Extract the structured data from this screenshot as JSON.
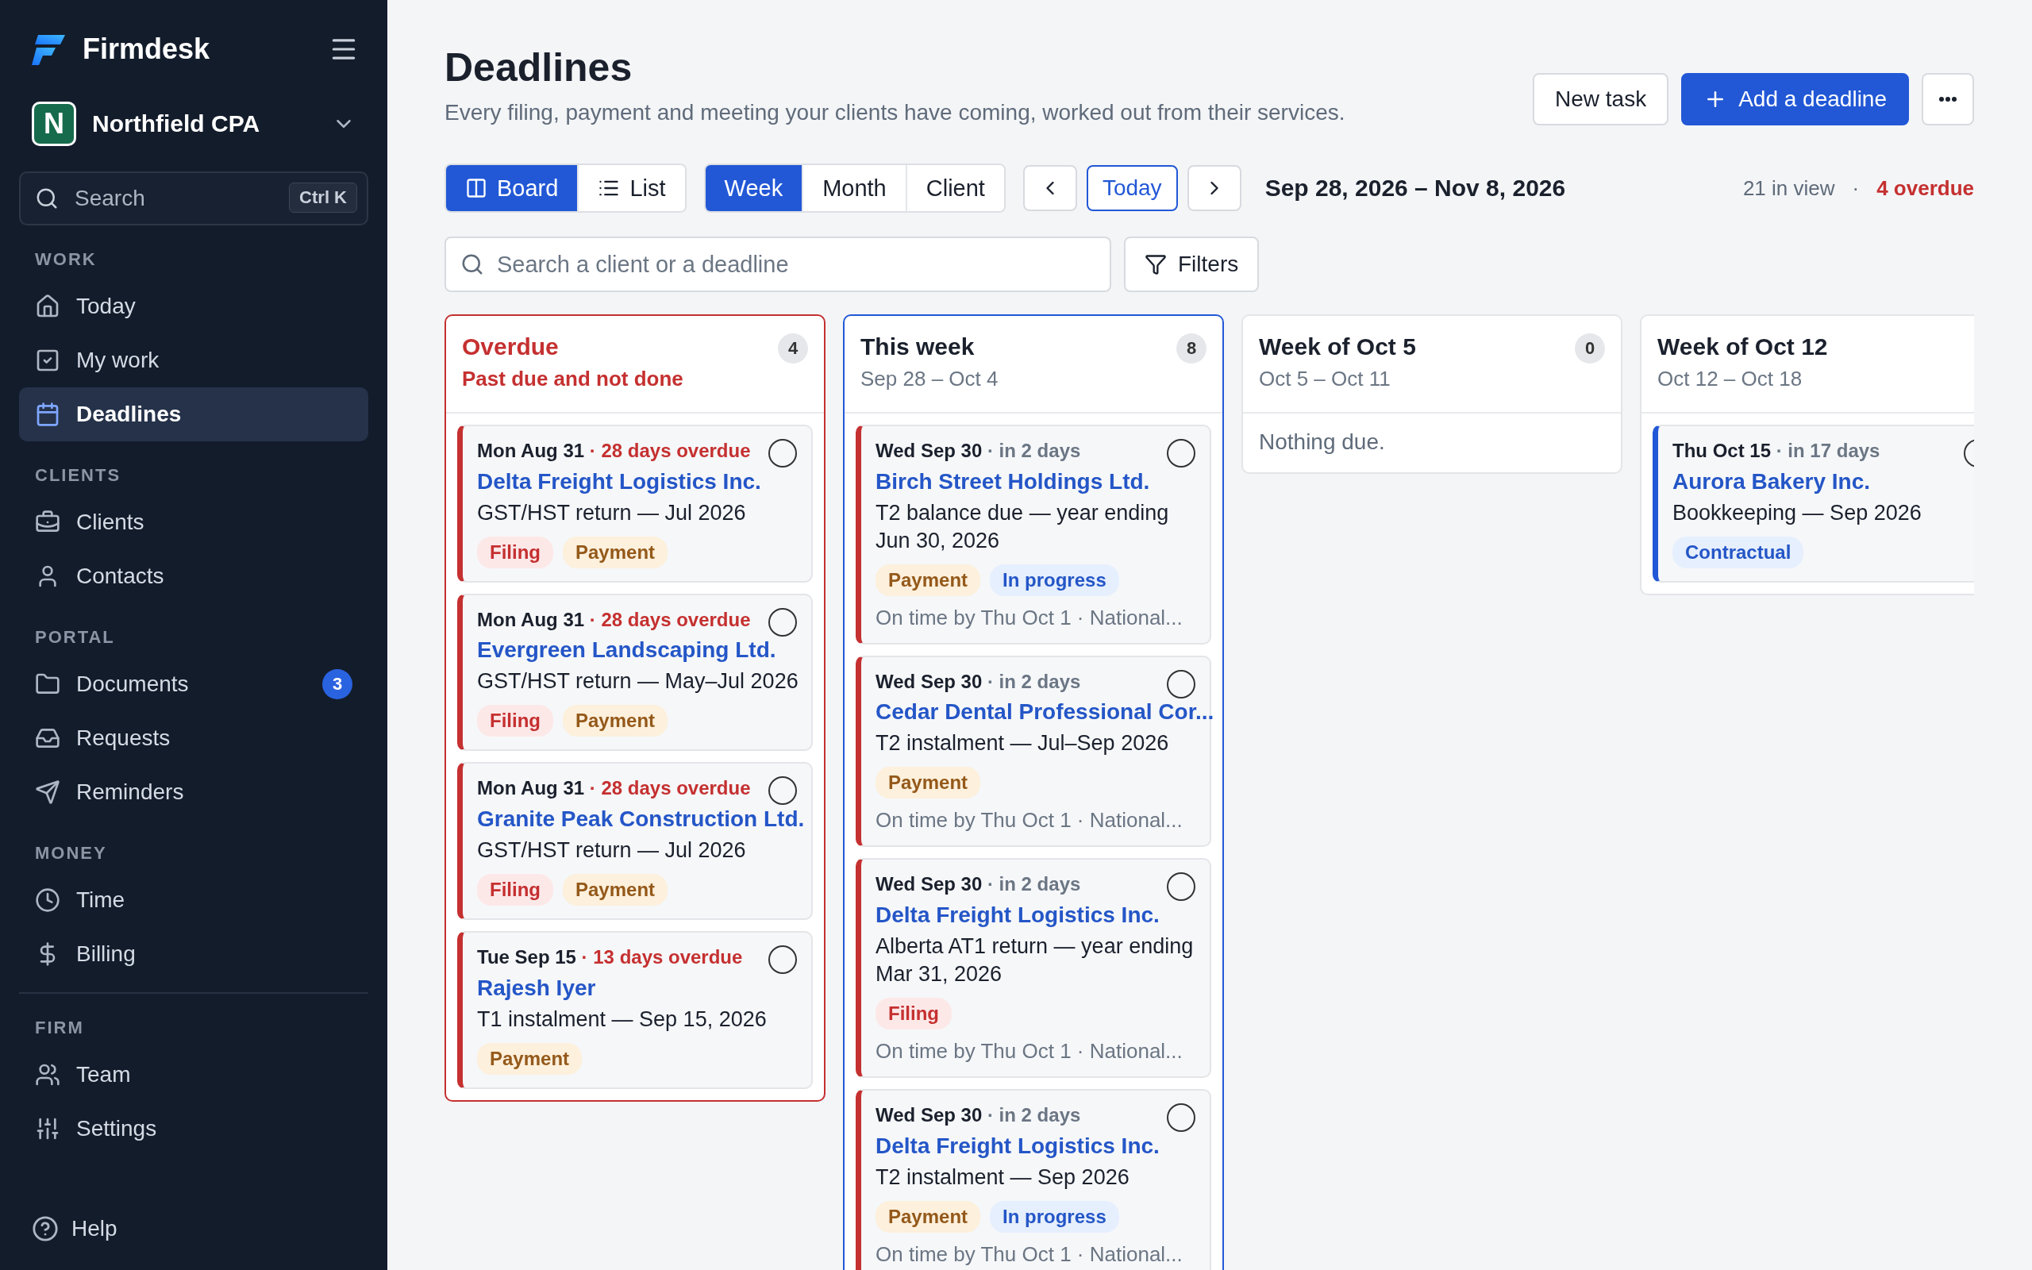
{
  "app": {
    "name": "Firmdesk"
  },
  "workspace": {
    "initial": "N",
    "name": "Northfield CPA"
  },
  "sidebar_search": {
    "placeholder": "Search",
    "shortcut": "Ctrl K"
  },
  "sidebar": {
    "sections": [
      {
        "title": "WORK",
        "divider_above": false,
        "items": [
          {
            "label": "Today",
            "selected": false
          },
          {
            "label": "My work",
            "selected": false
          },
          {
            "label": "Deadlines",
            "selected": true
          }
        ]
      },
      {
        "title": "CLIENTS",
        "divider_above": false,
        "items": [
          {
            "label": "Clients",
            "selected": false
          },
          {
            "label": "Contacts",
            "selected": false
          }
        ]
      },
      {
        "title": "PORTAL",
        "divider_above": false,
        "items": [
          {
            "label": "Documents",
            "selected": false,
            "badge": "3"
          },
          {
            "label": "Requests",
            "selected": false
          },
          {
            "label": "Reminders",
            "selected": false
          }
        ]
      },
      {
        "title": "MONEY",
        "divider_above": false,
        "items": [
          {
            "label": "Time",
            "selected": false
          },
          {
            "label": "Billing",
            "selected": false
          }
        ]
      },
      {
        "title": "FIRM",
        "divider_above": true,
        "items": [
          {
            "label": "Team",
            "selected": false
          },
          {
            "label": "Settings",
            "selected": false
          }
        ]
      }
    ],
    "help": {
      "label": "Help"
    }
  },
  "page": {
    "title": "Deadlines",
    "subtitle": "Every filing, payment and meeting your clients have coming, worked out from their services."
  },
  "actions": [
    {
      "kind": "secondary",
      "label": "New task"
    },
    {
      "kind": "primary",
      "label": "Add a deadline"
    },
    {
      "kind": "more"
    }
  ],
  "view_tabs": [
    {
      "label": "Board",
      "selected": true
    },
    {
      "label": "List",
      "selected": false
    }
  ],
  "range_tabs": [
    {
      "label": "Week",
      "selected": true
    },
    {
      "label": "Month",
      "selected": false
    },
    {
      "label": "Client",
      "selected": false
    }
  ],
  "nav": {
    "today": "Today"
  },
  "date_range": "Sep 28, 2026 – Nov 8, 2026",
  "summary": {
    "in_view": "21 in view",
    "separator": "·",
    "overdue": "4 overdue"
  },
  "board_search": {
    "placeholder": "Search a client or a deadline"
  },
  "filters": {
    "label": "Filters"
  },
  "columns": [
    {
      "kind": "overdue",
      "title": "Overdue",
      "subtitle": "Past due and not done",
      "count": "4",
      "cards": [
        {
          "urgent": true,
          "overdue": true,
          "checked": false,
          "when": "**Mon Aug 31** · 28 days overdue",
          "client": "Delta Freight Logistics Inc.",
          "task": "GST/HST return — Jul 2026",
          "tags": [
            {
              "kind": "filing",
              "label": "Filing"
            },
            {
              "kind": "payment",
              "label": "Payment"
            }
          ]
        },
        {
          "urgent": true,
          "overdue": true,
          "checked": false,
          "when": "**Mon Aug 31** · 28 days overdue",
          "client": "Evergreen Landscaping Ltd.",
          "task": "GST/HST return — May–Jul 2026",
          "tags": [
            {
              "kind": "filing",
              "label": "Filing"
            },
            {
              "kind": "payment",
              "label": "Payment"
            }
          ]
        },
        {
          "urgent": true,
          "overdue": true,
          "checked": false,
          "when": "**Mon Aug 31** · 28 days overdue",
          "client": "Granite Peak Construction Ltd.",
          "task": "GST/HST return — Jul 2026",
          "tags": [
            {
              "kind": "filing",
              "label": "Filing"
            },
            {
              "kind": "payment",
              "label": "Payment"
            }
          ]
        },
        {
          "urgent": true,
          "overdue": true,
          "checked": false,
          "when": "**Tue Sep 15** · 13 days overdue",
          "client": "Rajesh Iyer",
          "task": "T1 instalment — Sep 15, 2026",
          "tags": [
            {
              "kind": "payment",
              "label": "Payment"
            }
          ]
        }
      ]
    },
    {
      "kind": "current",
      "title": "This week",
      "subtitle": "Sep 28 – Oct 4",
      "count": "8",
      "cards": [
        {
          "urgent": true,
          "overdue": false,
          "checked": false,
          "when": "**Wed Sep 30** · in 2 days",
          "client": "Birch Street Holdings Ltd.",
          "task": "T2 balance due — year ending Jun 30, 2026",
          "tags": [
            {
              "kind": "payment",
              "label": "Payment"
            },
            {
              "kind": "status",
              "label": "In progress"
            }
          ],
          "note": "On time by Thu Oct 1 · National..."
        },
        {
          "urgent": true,
          "overdue": false,
          "checked": false,
          "when": "**Wed Sep 30** · in 2 days",
          "client": "Cedar Dental Professional Cor...",
          "task": "T2 instalment — Jul–Sep 2026",
          "tags": [
            {
              "kind": "payment",
              "label": "Payment"
            }
          ],
          "note": "On time by Thu Oct 1 · National..."
        },
        {
          "urgent": true,
          "overdue": false,
          "checked": false,
          "when": "**Wed Sep 30** · in 2 days",
          "client": "Delta Freight Logistics Inc.",
          "task": "Alberta AT1 return — year ending Mar 31, 2026",
          "tags": [
            {
              "kind": "filing",
              "label": "Filing"
            }
          ],
          "note": "On time by Thu Oct 1 · National..."
        },
        {
          "urgent": true,
          "overdue": false,
          "checked": false,
          "when": "**Wed Sep 30** · in 2 days",
          "client": "Delta Freight Logistics Inc.",
          "task": "T2 instalment — Sep 2026",
          "tags": [
            {
              "kind": "payment",
              "label": "Payment"
            },
            {
              "kind": "status",
              "label": "In progress"
            }
          ],
          "note": "On time by Thu Oct 1 · National..."
        }
      ]
    },
    {
      "kind": "future",
      "title": "Week of Oct 5",
      "subtitle": "Oct 5 – Oct 11",
      "count": "0",
      "empty": "Nothing due."
    },
    {
      "kind": "future",
      "title": "Week of Oct 12",
      "subtitle": "Oct 12 – Oct 18",
      "cards": [
        {
          "urgent": false,
          "overdue": false,
          "checked": false,
          "when": "**Thu Oct 15** · in 17 days",
          "client": "Aurora Bakery Inc.",
          "task": "Bookkeeping — Sep 2026",
          "tags": [
            {
              "kind": "status",
              "label": "Contractual"
            }
          ]
        }
      ]
    }
  ]
}
